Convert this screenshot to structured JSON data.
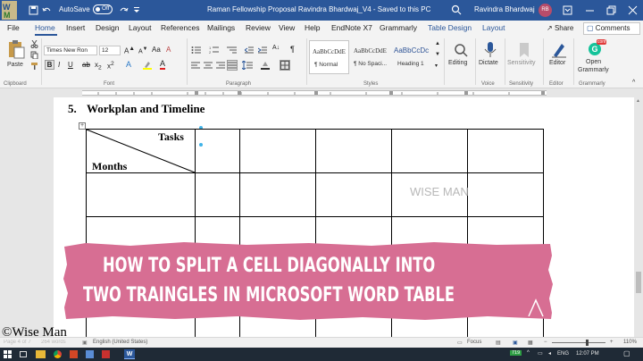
{
  "colors": {
    "word_blue": "#2b579a",
    "banner_pink": "#d76e93",
    "taskbar": "#1f2a36"
  },
  "titlebar": {
    "autosave_label": "AutoSave",
    "autosave_state": "Off",
    "title": "Raman Fellowship Proposal Ravindra Bhardwaj_V4 - Saved to this PC",
    "user": "Ravindra Bhardwaj",
    "avatar_initials": "RB",
    "icons": [
      "word-logo-icon",
      "save-icon",
      "undo-icon",
      "redo-icon",
      "qat-more-icon",
      "search-icon",
      "ribbon-display-icon",
      "minimize-icon",
      "maximize-icon",
      "close-icon"
    ]
  },
  "menu": {
    "tabs": [
      "File",
      "Home",
      "Insert",
      "Design",
      "Layout",
      "References",
      "Mailings",
      "Review",
      "View",
      "Help",
      "EndNote X7",
      "Grammarly",
      "Table Design",
      "Layout"
    ],
    "active": "Home",
    "share": "Share",
    "comments": "Comments"
  },
  "ribbon": {
    "clipboard": {
      "paste": "Paste",
      "label": "Clipboard"
    },
    "font": {
      "name": "Times New Ron",
      "size": "12",
      "label": "Font"
    },
    "paragraph": {
      "label": "Paragraph"
    },
    "styles": {
      "label": "Styles",
      "items": [
        {
          "sample": "AaBbCcDdE",
          "name": "¶ Normal"
        },
        {
          "sample": "AaBbCcDdE",
          "name": "¶ No Spaci..."
        },
        {
          "sample": "AaBbCcDc",
          "name": "Heading 1"
        }
      ]
    },
    "editing": {
      "label": "Editing"
    },
    "voice": {
      "button": "Dictate",
      "label": "Voice"
    },
    "sensitivity": {
      "button": "Sensitivity",
      "label": "Sensitivity"
    },
    "editor": {
      "button": "Editor",
      "label": "Editor"
    },
    "grammarly": {
      "button_line1": "Open",
      "button_line2": "Grammarly",
      "badge": "conf",
      "label": "Grammarly"
    }
  },
  "document": {
    "heading_number": "5.",
    "heading_text": "Workplan and Timeline",
    "cell_tasks": "Tasks",
    "cell_months": "Months",
    "watermark": "WISE MAN"
  },
  "banner": {
    "line1": "HOW TO SPLIT A CELL DIAGONALLY INTO",
    "line2": "TWO TRAINGLES IN MICROSOFT WORD TABLE"
  },
  "copyright": "©Wise Man",
  "statusbar": {
    "page": "Page 4 of 7",
    "words": "264 words",
    "language": "English (United States)",
    "focus": "Focus",
    "zoom": "110%"
  },
  "taskbar": {
    "battery": "719",
    "lang": "ENG",
    "time": "12:07 PM"
  }
}
